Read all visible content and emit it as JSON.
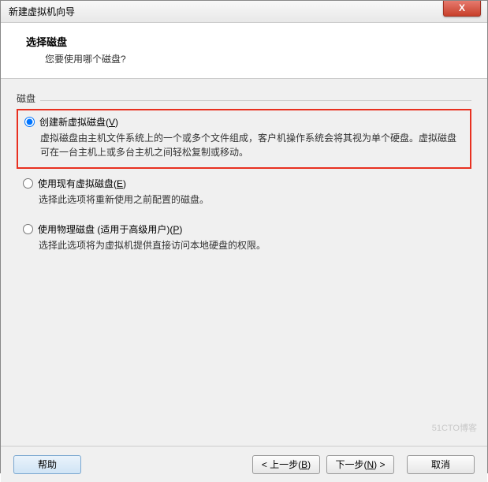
{
  "window": {
    "title": "新建虚拟机向导",
    "close": "X"
  },
  "header": {
    "title": "选择磁盘",
    "subtitle": "您要使用哪个磁盘?"
  },
  "group": {
    "label": "磁盘"
  },
  "options": [
    {
      "label_pre": "创建新虚拟磁盘(",
      "mnemonic": "V",
      "label_post": ")",
      "desc": "虚拟磁盘由主机文件系统上的一个或多个文件组成，客户机操作系统会将其视为单个硬盘。虚拟磁盘可在一台主机上或多台主机之间轻松复制或移动。",
      "checked": true,
      "highlighted": true
    },
    {
      "label_pre": "使用现有虚拟磁盘(",
      "mnemonic": "E",
      "label_post": ")",
      "desc": "选择此选项将重新使用之前配置的磁盘。",
      "checked": false,
      "highlighted": false
    },
    {
      "label_pre": "使用物理磁盘 (适用于高级用户)(",
      "mnemonic": "P",
      "label_post": ")",
      "desc": "选择此选项将为虚拟机提供直接访问本地硬盘的权限。",
      "checked": false,
      "highlighted": false
    }
  ],
  "buttons": {
    "help": "帮助",
    "back_pre": "< 上一步(",
    "back_m": "B",
    "back_post": ")",
    "next_pre": "下一步(",
    "next_m": "N",
    "next_post": ") >",
    "cancel": "取消"
  },
  "watermark": "51CTO博客"
}
